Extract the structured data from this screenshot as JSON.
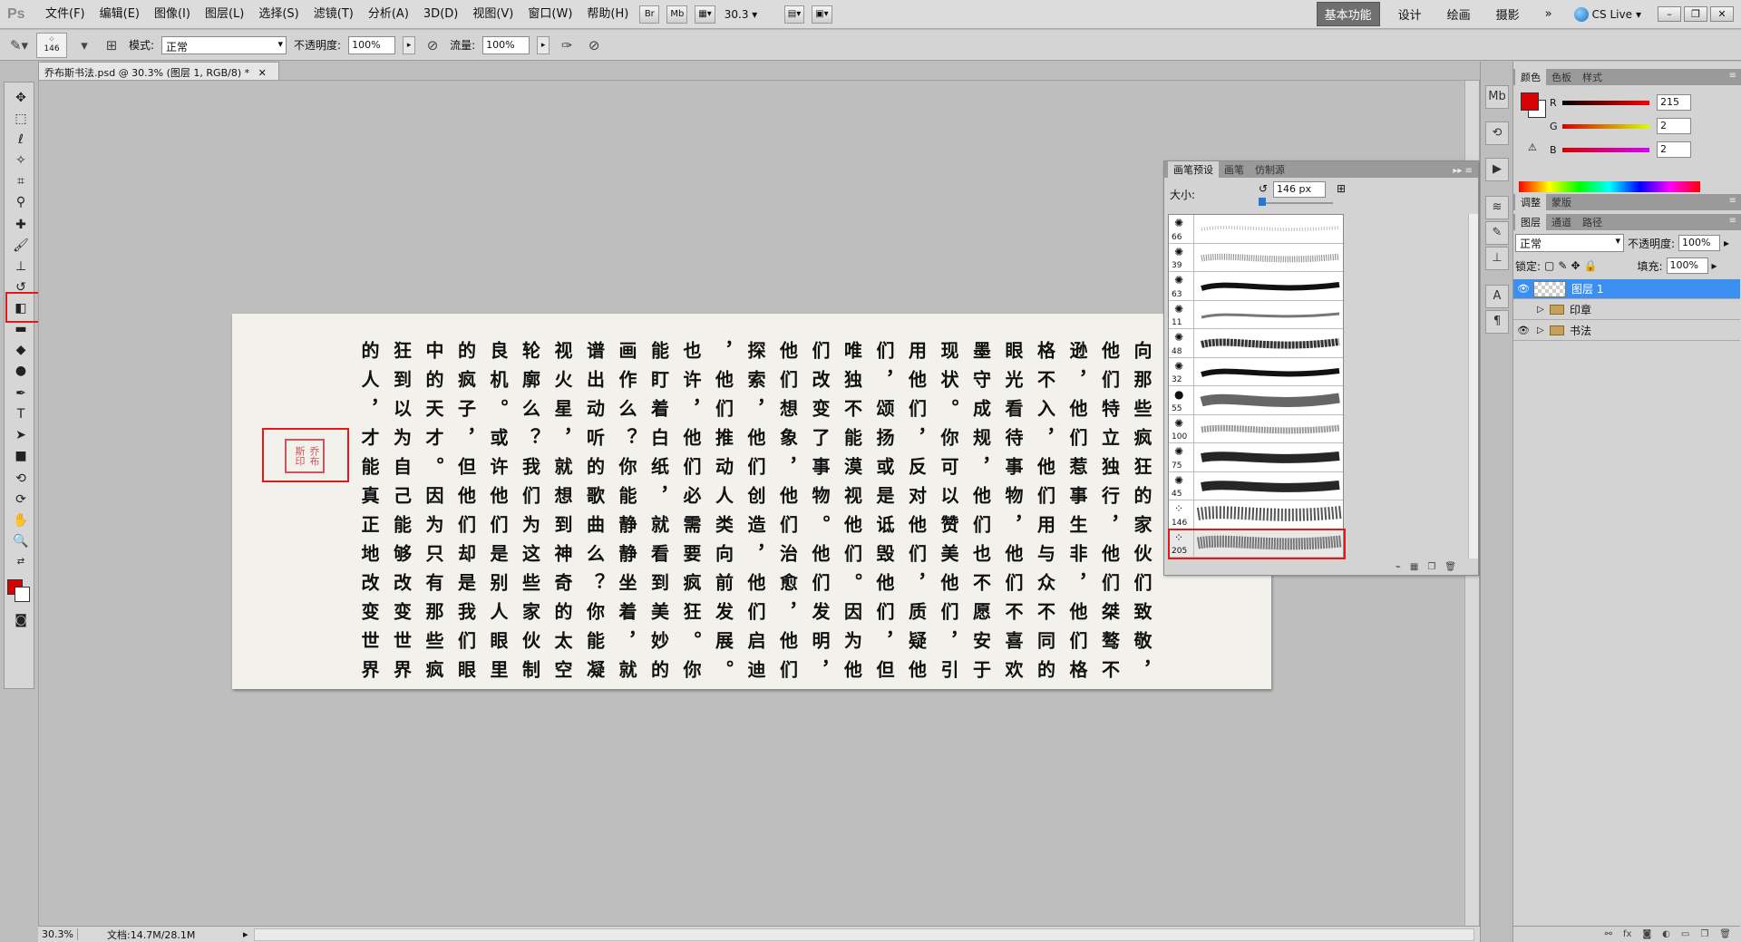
{
  "app": {
    "logo": "Ps",
    "menus": [
      "文件(F)",
      "编辑(E)",
      "图像(I)",
      "图层(L)",
      "选择(S)",
      "滤镜(T)",
      "分析(A)",
      "3D(D)",
      "视图(V)",
      "窗口(W)",
      "帮助(H)"
    ],
    "bridge_btn": "Br",
    "minibridge_btn": "Mb",
    "zoom_value": "30.3",
    "workspaces": [
      "基本功能",
      "设计",
      "绘画",
      "摄影"
    ],
    "more": "»",
    "cs_live": "CS Live"
  },
  "options_bar": {
    "brush_size": "146",
    "mode_label": "模式:",
    "mode_value": "正常",
    "opacity_label": "不透明度:",
    "opacity_value": "100%",
    "flow_label": "流量:",
    "flow_value": "100%"
  },
  "document": {
    "tab_title": "乔布斯书法.psd @ 30.3% (图层 1, RGB/8) *",
    "status_zoom": "30.3%",
    "status_doc": "文档:14.7M/28.1M",
    "seal_text": "乔布斯印",
    "calligraphy_columns": [
      "向那些疯狂的家伙们致敬，",
      "他们特立独行，他们桀骜不",
      "逊，他们惹事生非，他们格",
      "格不入，他们用与众不同的",
      "眼光看待事物，他们不喜欢",
      "墨守成规，他们也不愿安于",
      "现状。你可以赞美他们，引",
      "用他们，反对他们，质疑他",
      "们，颂扬或是诋毁他们，但",
      "唯独不能漠视他们。因为他",
      "们改变了事物。他们发明，",
      "他们想象，他们治愈，他们",
      "探索，他们创造，他们启迪",
      "，他们推动人类向前发展。",
      "也许，他们必需要疯狂。你",
      "能盯着白纸，就看到美妙的",
      "画作么？你能静静坐着，就",
      "谱出动听的歌曲么？你能凝",
      "视火星，就想到神奇的太空",
      "轮廓么？我们为这些家伙制",
      "良机。或许他们是别人眼里",
      "的疯子，但他们却是我们眼",
      "中的天才。因为只有那些疯",
      "狂到以为自己能够改变世界",
      "的人，才能真正地改变世界"
    ]
  },
  "brush_panel": {
    "tabs": [
      "画笔预设",
      "画笔",
      "仿制源"
    ],
    "size_label": "大小:",
    "size_value": "146 px",
    "presets": [
      {
        "size": "66",
        "style": "spray-light"
      },
      {
        "size": "39",
        "style": "spray"
      },
      {
        "size": "63",
        "style": "hard-wave"
      },
      {
        "size": "11",
        "style": "thin-wave"
      },
      {
        "size": "48",
        "style": "rough-wave"
      },
      {
        "size": "32",
        "style": "hard-wave"
      },
      {
        "size": "55",
        "style": "soft-thick"
      },
      {
        "size": "100",
        "style": "fuzzy"
      },
      {
        "size": "75",
        "style": "airbrush"
      },
      {
        "size": "45",
        "style": "airbrush"
      },
      {
        "size": "146",
        "style": "pattern"
      },
      {
        "size": "205",
        "style": "pattern-soft"
      }
    ],
    "selected_index": 11
  },
  "color_panel": {
    "tabs": [
      "颜色",
      "色板",
      "样式"
    ],
    "r_label": "R",
    "r_value": "215",
    "g_label": "G",
    "g_value": "2",
    "b_label": "B",
    "b_value": "2",
    "fg_color": "#d70202"
  },
  "adjust_panel": {
    "tabs": [
      "调整",
      "蒙版"
    ]
  },
  "layers_panel": {
    "tabs": [
      "图层",
      "通道",
      "路径"
    ],
    "blend_mode": "正常",
    "opacity_label": "不透明度:",
    "opacity_value": "100%",
    "lock_label": "锁定:",
    "fill_label": "填充:",
    "fill_value": "100%",
    "layers": [
      {
        "name": "图层 1",
        "selected": true,
        "visible": true,
        "type": "layer"
      },
      {
        "name": "印章",
        "selected": false,
        "visible": false,
        "type": "group"
      },
      {
        "name": "书法",
        "selected": false,
        "visible": true,
        "type": "group"
      }
    ]
  }
}
